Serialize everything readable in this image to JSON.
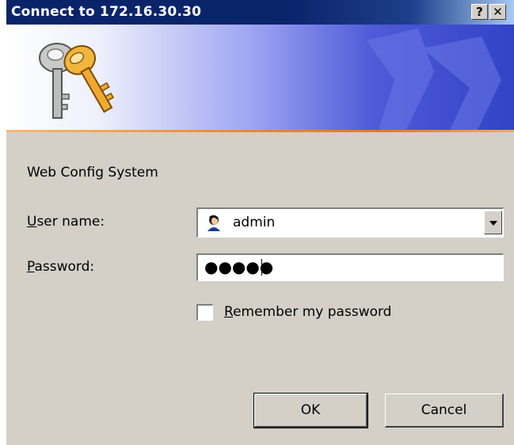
{
  "window": {
    "title": "Connect to 172.16.30.30",
    "help_label": "?",
    "close_label": "✕"
  },
  "dialog": {
    "heading": "Web Config System",
    "username": {
      "label_accel": "U",
      "label_rest": "ser name:",
      "value": "admin",
      "icon": "user-icon"
    },
    "password": {
      "label_accel": "P",
      "label_rest": "assword:",
      "masked_value": "●●●●●"
    },
    "remember": {
      "label_accel": "R",
      "label_rest": "emember my password",
      "checked": false
    },
    "buttons": {
      "ok": "OK",
      "cancel": "Cancel"
    }
  },
  "colors": {
    "titlebar": "#0a246a",
    "face": "#d4d0c8",
    "banner_accent": "#f08a2c"
  }
}
